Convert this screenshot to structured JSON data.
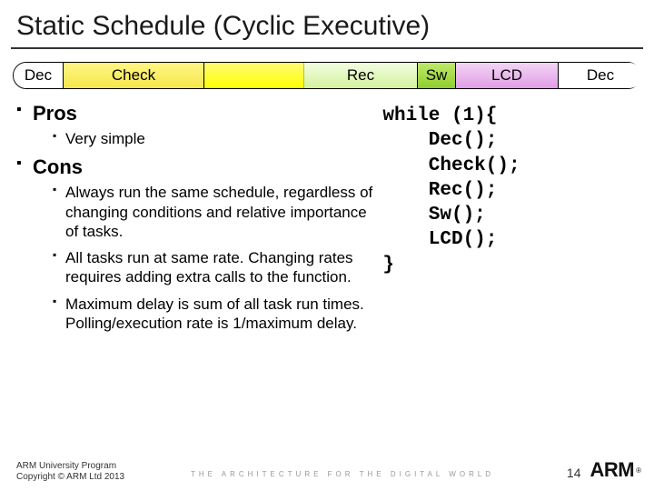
{
  "title": "Static Schedule (Cyclic Executive)",
  "timeline": {
    "dec": "Dec",
    "check": "Check",
    "rec": "Rec",
    "sw": "Sw",
    "lcd": "LCD",
    "dec2": "Dec"
  },
  "pros": {
    "heading": "Pros",
    "items": [
      "Very simple"
    ]
  },
  "cons": {
    "heading": "Cons",
    "items": [
      "Always run the same schedule, regardless of changing conditions and relative importance of tasks.",
      "All tasks run at same rate. Changing rates requires adding extra calls to the function.",
      "Maximum delay is sum of all task run times. Polling/execution rate is 1/maximum delay."
    ]
  },
  "code": "while (1){\n    Dec();\n    Check();\n    Rec();\n    Sw();\n    LCD();\n}",
  "footer": {
    "line1": "ARM University Program",
    "line2": "Copyright © ARM Ltd 2013",
    "slidenum": "14",
    "logo": "ARM",
    "tagline": "THE ARCHITECTURE FOR THE DIGITAL WORLD"
  }
}
